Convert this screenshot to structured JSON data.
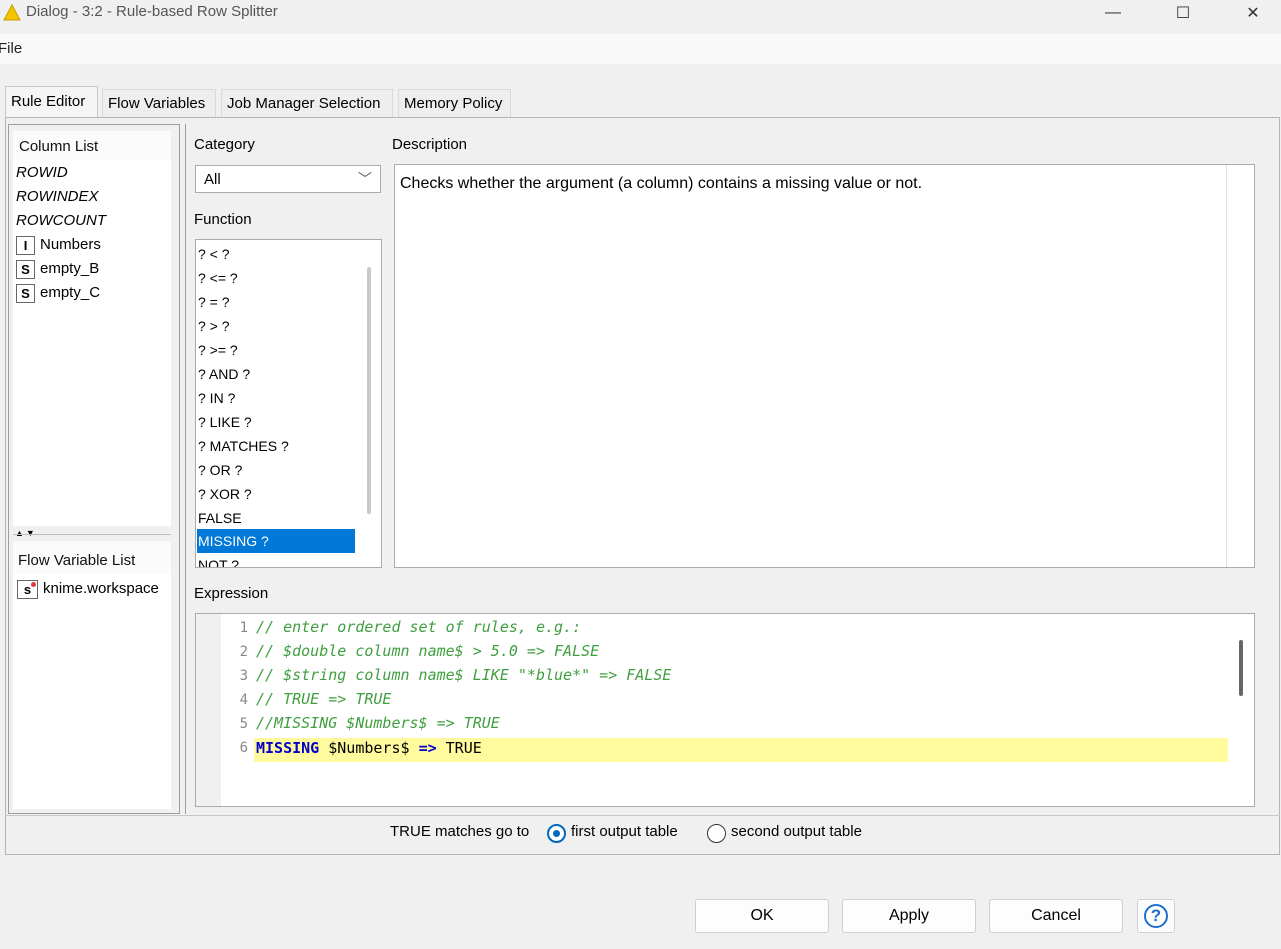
{
  "window": {
    "title": "Dialog - 3:2 - Rule-based Row Splitter",
    "minimize_glyph": "—",
    "maximize_glyph": "☐",
    "close_glyph": "✕"
  },
  "menu": {
    "file": "File"
  },
  "tabs": [
    {
      "label": "Rule Editor",
      "active": true
    },
    {
      "label": "Flow Variables"
    },
    {
      "label": "Job Manager Selection"
    },
    {
      "label": "Memory Policy"
    }
  ],
  "column_list": {
    "heading": "Column List",
    "items": [
      {
        "label": "ROWID",
        "type": ""
      },
      {
        "label": "ROWINDEX",
        "type": ""
      },
      {
        "label": "ROWCOUNT",
        "type": ""
      },
      {
        "label": "Numbers",
        "type": "I"
      },
      {
        "label": "empty_B",
        "type": "S"
      },
      {
        "label": "empty_C",
        "type": "S"
      }
    ]
  },
  "flow_variable_list": {
    "heading": "Flow Variable List",
    "items": [
      {
        "label": "knime.workspace",
        "type": "s"
      }
    ]
  },
  "category": {
    "label": "Category",
    "selected": "All"
  },
  "function": {
    "label": "Function",
    "items": [
      "? < ?",
      "? <= ?",
      "? = ?",
      "? > ?",
      "? >= ?",
      "? AND ?",
      "? IN ?",
      "? LIKE ?",
      "? MATCHES ?",
      "? OR ?",
      "? XOR ?",
      "FALSE",
      "MISSING ?",
      "NOT ?"
    ],
    "selected": "MISSING ?"
  },
  "description": {
    "label": "Description",
    "text": "Checks whether the argument (a column) contains a missing value or not."
  },
  "expression": {
    "label": "Expression",
    "lines": [
      {
        "num": "1",
        "text": "// enter ordered set of rules, e.g.:"
      },
      {
        "num": "2",
        "text": "// $double column name$ > 5.0 => FALSE"
      },
      {
        "num": "3",
        "text": "// $string column name$ LIKE \"*blue*\" => FALSE"
      },
      {
        "num": "4",
        "text": "// TRUE => TRUE"
      },
      {
        "num": "5",
        "text": "//MISSING $Numbers$ => TRUE"
      },
      {
        "num": "6",
        "kw1": "MISSING",
        "mid": " $Numbers$ ",
        "kw2": "=>",
        "rest": " TRUE"
      }
    ]
  },
  "output": {
    "label": "TRUE matches go to",
    "first": "first output table",
    "second": "second output table",
    "selected": "first"
  },
  "buttons": {
    "ok": "OK",
    "apply": "Apply",
    "cancel": "Cancel",
    "help": "?"
  },
  "colors": {
    "selection": "#0078d7",
    "comment": "#3f9f3f",
    "keyword": "#0000c8",
    "current_line": "#fffa9e",
    "radio": "#0067c0",
    "app_icon": "#f5c400"
  }
}
